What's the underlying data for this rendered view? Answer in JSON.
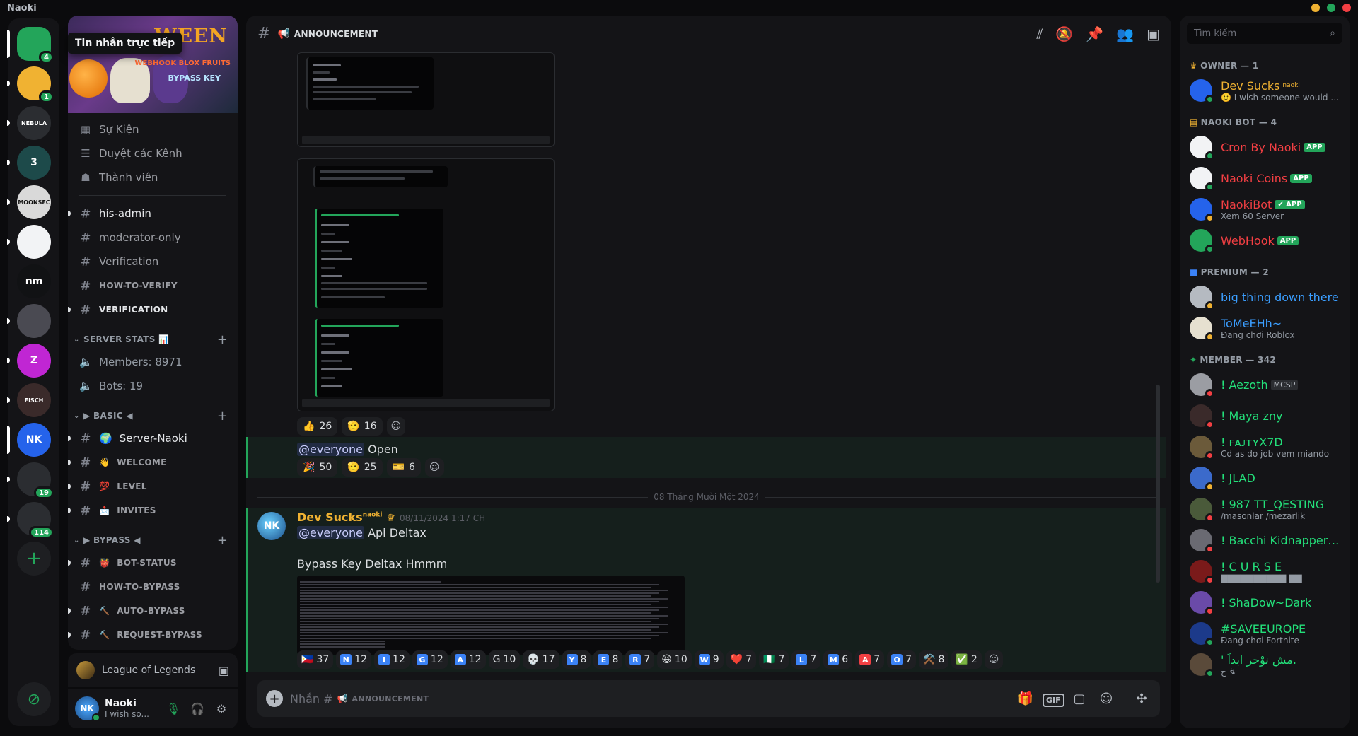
{
  "app": {
    "title": "Naoki"
  },
  "window_controls": {
    "min_color": "#f0b232",
    "max_color": "#23a55a",
    "close_color": "#f23f43"
  },
  "tooltip": {
    "text": "Tin nhắn trực tiếp"
  },
  "rail": {
    "servers": [
      {
        "name": "Direct Messages",
        "label": "",
        "color": "#23a55a",
        "badge": "4"
      },
      {
        "name": "Server 2",
        "label": "",
        "color": "#f0b232",
        "badge": "1"
      },
      {
        "name": "Nebula",
        "label": "NEBULA",
        "color": "#2b2d31",
        "badge": ""
      },
      {
        "name": "Server 3",
        "label": "3",
        "color": "#1d4a4a",
        "badge": ""
      },
      {
        "name": "Moonsec",
        "label": "MOONSEC",
        "color": "#d9d9d9",
        "badge": ""
      },
      {
        "name": "Server 6",
        "label": "",
        "color": "#f2f3f5",
        "badge": ""
      },
      {
        "name": "nm",
        "label": "nm",
        "color": "#111214",
        "badge": ""
      },
      {
        "name": "Panda",
        "label": "",
        "color": "#4a4a52",
        "badge": ""
      },
      {
        "name": "Z server",
        "label": "Z",
        "color": "#c026d3",
        "badge": ""
      },
      {
        "name": "Fisch",
        "label": "FISCH",
        "color": "#3a2a2a",
        "badge": ""
      },
      {
        "name": "NK",
        "label": "NK",
        "color": "#2563eb",
        "badge": ""
      },
      {
        "name": "Server 12",
        "label": "",
        "color": "#2b2d31",
        "badge": "19"
      },
      {
        "name": "Folder",
        "label": "",
        "color": "#2b2d31",
        "badge": "114"
      }
    ],
    "add_label": "+",
    "discover_label": "⊘"
  },
  "banner": {
    "title": "WEEN",
    "tag1": "WEBHOOK BLOX FRUITS",
    "tag2": "BYPASS KEY"
  },
  "nav": [
    {
      "icon": "calendar-icon",
      "glyph": "▦",
      "label": "Sự Kiện"
    },
    {
      "icon": "browse-channels-icon",
      "glyph": "☰",
      "label": "Duyệt các Kênh"
    },
    {
      "icon": "members-icon",
      "glyph": "☗",
      "label": "Thành viên"
    }
  ],
  "channels_top": [
    {
      "label": "his-admin",
      "unread": true
    },
    {
      "label": "moderator-only",
      "unread": false
    },
    {
      "label": "Verification",
      "unread": false
    },
    {
      "label": "HOW-TO-VERIFY",
      "unread": false
    },
    {
      "label": "VERIFICATION",
      "unread": true
    }
  ],
  "server_stats": {
    "category": "SERVER STATS 📊",
    "members": "Members: 8971",
    "bots": "Bots: 19"
  },
  "basic": {
    "category": "▶ BASIC ◀",
    "channels": [
      {
        "emoji": "🌍",
        "label": "Server-Naoki"
      },
      {
        "emoji": "👋",
        "label": "WELCOME"
      },
      {
        "emoji": "💯",
        "label": "LEVEL"
      },
      {
        "emoji": "📩",
        "label": "INVITES"
      }
    ]
  },
  "bypass": {
    "category": "▶ BYPASS ◀",
    "channels": [
      {
        "emoji": "👹",
        "label": "BOT-STATUS"
      },
      {
        "emoji": "",
        "label": "HOW-TO-BYPASS"
      },
      {
        "emoji": "🔨",
        "label": "AUTO-BYPASS"
      },
      {
        "emoji": "🔨",
        "label": "REQUEST-BYPASS"
      }
    ]
  },
  "activity": {
    "text": "League of Legends"
  },
  "user": {
    "name": "Naoki",
    "status": "I wish so..."
  },
  "header": {
    "channel": "ANNOUNCEMENT",
    "flag": "📢"
  },
  "messages": {
    "reactions1": [
      {
        "emoji": "👍",
        "count": "26"
      },
      {
        "emoji": "🫡",
        "count": "16"
      }
    ],
    "everyone_open": {
      "mention": "@everyone",
      "text": "Open"
    },
    "reactions2": [
      {
        "emoji": "🎉",
        "count": "50"
      },
      {
        "emoji": "🫡",
        "count": "25"
      },
      {
        "emoji": "🎫",
        "count": "6"
      }
    ],
    "date_divider": "08 Tháng Mười Một 2024",
    "dev_msg": {
      "author": "Dev Sucks",
      "author_tag": "naoki",
      "time": "08/11/2024 1:17 CH",
      "mention": "@everyone",
      "line1": "Api Deltax",
      "line2": "Bypass Key Deltax Hmmm",
      "avatar_label": "NK"
    },
    "reactions3": [
      {
        "emoji": "🇵🇭",
        "count": "37",
        "box": ""
      },
      {
        "emoji": "N",
        "count": "12",
        "box": "N"
      },
      {
        "emoji": "I",
        "count": "12",
        "box": "I"
      },
      {
        "emoji": "G",
        "count": "12",
        "box": "G"
      },
      {
        "emoji": "A",
        "count": "12",
        "box": "A"
      },
      {
        "emoji": "G",
        "count": "10",
        "box": ""
      },
      {
        "emoji": "💀",
        "count": "17",
        "box": ""
      },
      {
        "emoji": "Y",
        "count": "8",
        "box": "Y"
      },
      {
        "emoji": "E",
        "count": "8",
        "box": "E"
      },
      {
        "emoji": "R",
        "count": "7",
        "box": "R"
      },
      {
        "emoji": "😆",
        "count": "10",
        "box": ""
      },
      {
        "emoji": "W",
        "count": "9",
        "box": "W"
      },
      {
        "emoji": "❤️",
        "count": "7",
        "box": ""
      },
      {
        "emoji": "🇳🇬",
        "count": "7",
        "box": ""
      },
      {
        "emoji": "L",
        "count": "7",
        "box": "L"
      },
      {
        "emoji": "M",
        "count": "6",
        "box": "M"
      },
      {
        "emoji": "A",
        "count": "7",
        "box": "A"
      },
      {
        "emoji": "O",
        "count": "7",
        "box": "O"
      },
      {
        "emoji": "⚒️",
        "count": "8",
        "box": ""
      },
      {
        "emoji": "✅",
        "count": "2",
        "box": ""
      }
    ]
  },
  "composer": {
    "placeholder": "Nhắn #",
    "channel": "ANNOUNCEMENT"
  },
  "members": {
    "search_placeholder": "Tìm kiếm",
    "groups": [
      {
        "title": "OWNER — 1",
        "members": [
          {
            "name": "Dev Sucks",
            "tag": "naoki",
            "status": "🙂 I wish someone would gif...",
            "color": "#f0b232",
            "app": "",
            "av": "#2563eb",
            "st": "#23a55a"
          }
        ]
      },
      {
        "title": "NAOKI BOT — 4",
        "members": [
          {
            "name": "Cron By Naoki",
            "tag": "",
            "status": "",
            "color": "#f23f43",
            "app": "APP",
            "av": "#f2f3f5",
            "st": "#23a55a"
          },
          {
            "name": "Naoki Coins",
            "tag": "",
            "status": "",
            "color": "#f23f43",
            "app": "APP",
            "av": "#f2f3f5",
            "st": "#23a55a"
          },
          {
            "name": "NaokiBot",
            "tag": "",
            "status": "Xem 60 Server",
            "color": "#f23f43",
            "app": "✔ APP",
            "av": "#2563eb",
            "st": "#f0b232"
          },
          {
            "name": "WebHook",
            "tag": "",
            "status": "",
            "color": "#f23f43",
            "app": "APP",
            "av": "#23a55a",
            "st": "#23a55a"
          }
        ]
      },
      {
        "title": "PREMIUM — 2",
        "members": [
          {
            "name": "big thing down there",
            "tag": "",
            "status": "",
            "color": "#3b9eff",
            "app": "",
            "av": "#b5bac1",
            "st": "#f0b232"
          },
          {
            "name": "ToMeEHh~",
            "tag": "",
            "status": "Đang chơi Roblox",
            "color": "#3b9eff",
            "app": "",
            "av": "#e6e0d0",
            "st": "#f0b232"
          }
        ]
      },
      {
        "title": "MEMBER — 342",
        "members": [
          {
            "name": "! Aezoth",
            "tag": "MCSP",
            "status": "",
            "color": "#23e07a",
            "app": "",
            "av": "#9b9da3",
            "st": "#f23f43"
          },
          {
            "name": "! Maya zny",
            "tag": "",
            "status": "",
            "color": "#23e07a",
            "app": "",
            "av": "#3a2a2a",
            "st": "#f23f43"
          },
          {
            "name": "! ꜰᴀᴊᴛʏX7D",
            "tag": "",
            "status": "Cd as do job vem miando",
            "color": "#23e07a",
            "app": "",
            "av": "#6b5a3a",
            "st": "#f23f43"
          },
          {
            "name": "! JLAD",
            "tag": "",
            "status": "",
            "color": "#23e07a",
            "app": "",
            "av": "#3b6acb",
            "st": "#f0b232"
          },
          {
            "name": "! 987 TT_QESTING",
            "tag": "",
            "status": "/masonlar /mezarlik",
            "color": "#23e07a",
            "app": "",
            "av": "#4a5a3a",
            "st": "#f23f43"
          },
          {
            "name": "! Bacchi Kidnapper ! ...",
            "tag": "",
            "status": "",
            "color": "#23e07a",
            "app": "",
            "av": "#6a6a72",
            "st": "#f23f43"
          },
          {
            "name": "! C U R S E",
            "tag": "",
            "status": "▇▇▇▇▇▇▇▇▇▇ ▇▇",
            "color": "#23e07a",
            "app": "",
            "av": "#7a1a1a",
            "st": "#f23f43"
          },
          {
            "name": "! ShaDow~Dark",
            "tag": "",
            "status": "",
            "color": "#23e07a",
            "app": "",
            "av": "#6a4aa8",
            "st": "#f23f43"
          },
          {
            "name": "#SAVEEUROPE",
            "tag": "",
            "status": "Đang chơi Fortnite",
            "color": "#23e07a",
            "app": "",
            "av": "#1c3a8a",
            "st": "#23a55a"
          },
          {
            "name": "' مش نوْحر ابداً.",
            "tag": "",
            "status": "ج ↯",
            "color": "#23e07a",
            "app": "",
            "av": "#5a4a3a",
            "st": "#23a55a"
          }
        ]
      }
    ]
  }
}
